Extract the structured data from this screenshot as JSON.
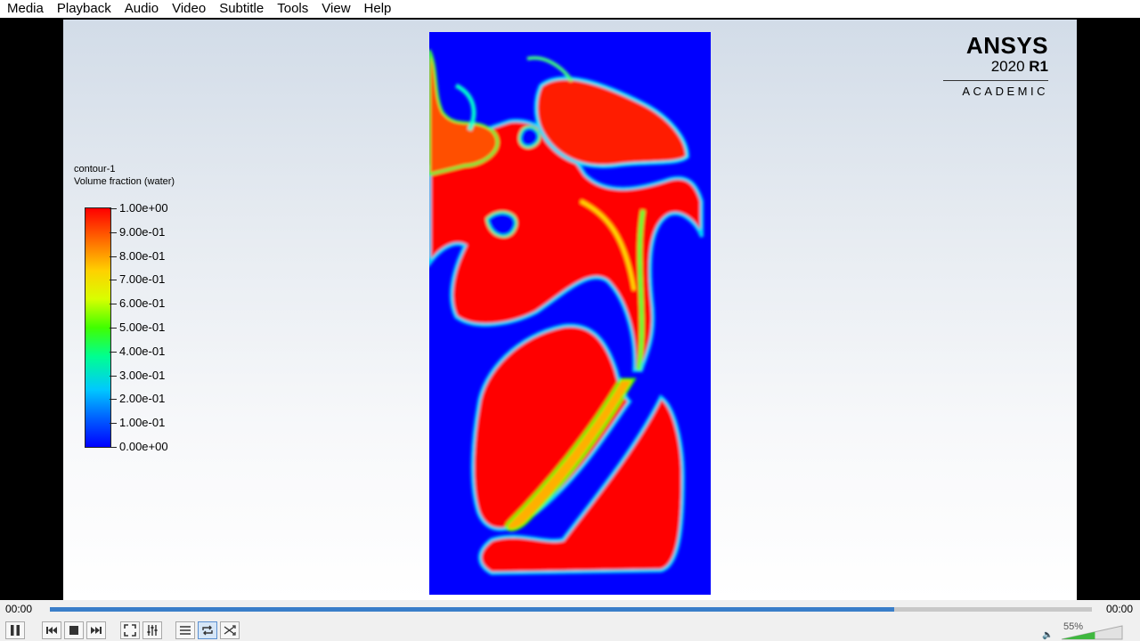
{
  "menu": [
    "Media",
    "Playback",
    "Audio",
    "Video",
    "Subtitle",
    "Tools",
    "View",
    "Help"
  ],
  "legend": {
    "name": "contour-1",
    "quantity": "Volume fraction (water)",
    "labels": [
      "1.00e+00",
      "9.00e-01",
      "8.00e-01",
      "7.00e-01",
      "6.00e-01",
      "5.00e-01",
      "4.00e-01",
      "3.00e-01",
      "2.00e-01",
      "1.00e-01",
      "0.00e+00"
    ]
  },
  "logo": {
    "brand": "ANSYS",
    "version": "2020",
    "release": "R1",
    "edition": "ACADEMIC"
  },
  "player": {
    "time_elapsed": "00:00",
    "time_total": "00:00",
    "progress": 0.81,
    "volume": "55%"
  },
  "buttons": [
    {
      "name": "pause-button",
      "icon": "pause-icon"
    },
    {
      "name": "previous-button",
      "icon": "skip-back-icon"
    },
    {
      "name": "stop-button",
      "icon": "stop-icon"
    },
    {
      "name": "next-button",
      "icon": "skip-forward-icon"
    },
    {
      "name": "fullscreen-button",
      "icon": "fullscreen-icon"
    },
    {
      "name": "extended-settings-button",
      "icon": "equalizer-icon"
    },
    {
      "name": "playlist-button",
      "icon": "playlist-icon"
    },
    {
      "name": "loop-button",
      "icon": "loop-icon"
    },
    {
      "name": "shuffle-button",
      "icon": "shuffle-icon"
    }
  ],
  "colors": {
    "water": "#ff0000",
    "air": "#0000ff",
    "seek_fill": "#3a7ec9"
  }
}
